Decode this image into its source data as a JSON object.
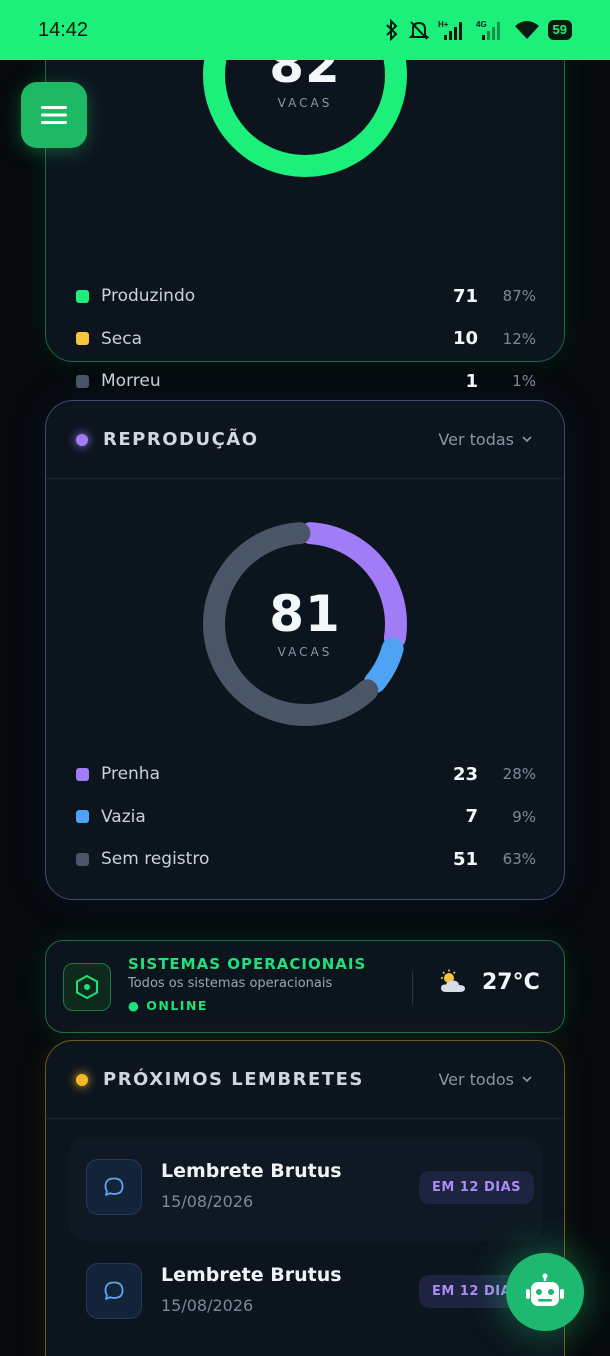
{
  "status_bar": {
    "time": "14:42",
    "network_labels": [
      "H+",
      "4G"
    ],
    "battery": "59"
  },
  "herd": {
    "total": "82",
    "unit": "VACAS",
    "ring_color": "#1df07a",
    "legend": [
      {
        "label": "Produzindo",
        "count": "71",
        "pct": "87%",
        "color": "#1df07a"
      },
      {
        "label": "Seca",
        "count": "10",
        "pct": "12%",
        "color": "#f5c53a"
      },
      {
        "label": "Morreu",
        "count": "1",
        "pct": "1%",
        "color": "#4a5565"
      }
    ]
  },
  "reproduction": {
    "title": "REPRODUÇÃO",
    "link": "Ver todas",
    "dot_color": "#a17cf7",
    "total": "81",
    "unit": "VACAS",
    "legend": [
      {
        "label": "Prenha",
        "count": "23",
        "pct": "28%",
        "color": "#a17cf7"
      },
      {
        "label": "Vazia",
        "count": "7",
        "pct": "9%",
        "color": "#4ea3f5"
      },
      {
        "label": "Sem registro",
        "count": "51",
        "pct": "63%",
        "color": "#4a5565"
      }
    ]
  },
  "system": {
    "title": "SISTEMAS OPERACIONAIS",
    "subtitle": "Todos os sistemas operacionais",
    "status": "● ONLINE",
    "temperature": "27°C",
    "weather_icon": "partly-cloudy-icon"
  },
  "reminders": {
    "title": "PRÓXIMOS LEMBRETES",
    "link": "Ver todos",
    "dot_color": "#f5b82a",
    "items": [
      {
        "title": "Lembrete Brutus",
        "date": "15/08/2026",
        "badge": "EM 12 DIAS"
      },
      {
        "title": "Lembrete Brutus",
        "date": "15/08/2026",
        "badge": "EM 12 DIAS"
      }
    ]
  },
  "buttons": {
    "menu_icon": "hamburger-icon",
    "assistant_icon": "robot-icon"
  }
}
